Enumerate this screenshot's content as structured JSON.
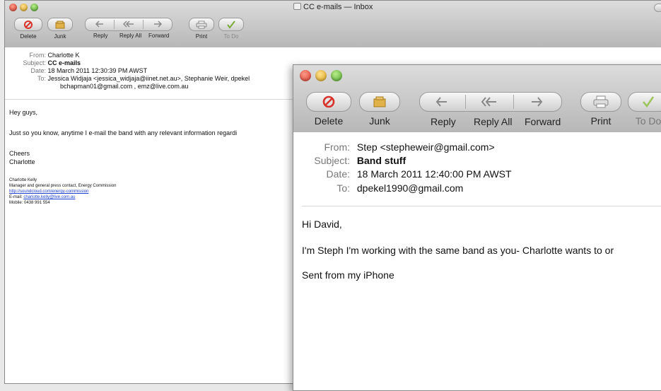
{
  "back_window": {
    "title": "CC e-mails — Inbox",
    "toolbar": {
      "delete": "Delete",
      "junk": "Junk",
      "reply": "Reply",
      "reply_all": "Reply All",
      "forward": "Forward",
      "print": "Print",
      "todo": "To Do"
    },
    "header": {
      "from_label": "From:",
      "from": "Charlotte K",
      "subject_label": "Subject:",
      "subject": "CC e-mails",
      "date_label": "Date:",
      "date": "18 March 2011 12:30:39 PM AWST",
      "to_label": "To:",
      "to_line1": "Jessica Widjaja <jessica_widjaja@iinet.net.au>,  Stephanie Weir,  dpekel",
      "to_line2": "bchapman01@gmail.com ,  emz@live.com.au"
    },
    "body": {
      "greeting": "Hey guys,",
      "line1": "Just so you know, anytime I e-mail the band with any relevant information regardi",
      "cheers": "Cheers",
      "name": "Charlotte",
      "sig_name": "Charlotte Kelly",
      "sig_role": "Manager and general press contact, Energy Commission",
      "sig_link": "http://soundcloud.com/energy-commission",
      "sig_email_label": "E-mail: ",
      "sig_email": "charlotte.kelly@live.com.au",
      "sig_mobile": "Mobile: 0438 991 554"
    }
  },
  "front_window": {
    "toolbar": {
      "delete": "Delete",
      "junk": "Junk",
      "reply": "Reply",
      "reply_all": "Reply All",
      "forward": "Forward",
      "print": "Print",
      "todo": "To Do"
    },
    "header": {
      "from_label": "From:",
      "from": "Step <stepheweir@gmail.com>",
      "subject_label": "Subject:",
      "subject": "Band stuff",
      "date_label": "Date:",
      "date": "18 March 2011 12:40:00 PM AWST",
      "to_label": "To:",
      "to": "dpekel1990@gmail.com"
    },
    "body": {
      "greeting": "Hi David,",
      "line1": "I'm Steph I'm working with the same band as you- Charlotte wants to or",
      "line2": "Sent from my iPhone"
    }
  },
  "colors": {
    "delete_icon": "#d8322a",
    "junk_icon": "#c89a2a",
    "todo_icon": "#7cab3a",
    "link": "#1a3fcc"
  }
}
